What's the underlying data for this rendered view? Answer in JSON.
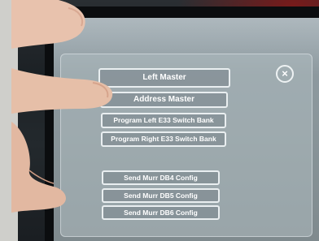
{
  "dialog": {
    "close_symbol": "×",
    "buttons": [
      {
        "label": "Left Master"
      },
      {
        "label": "Address Master"
      },
      {
        "label": "Program Left E33 Switch Bank"
      },
      {
        "label": "Program Right E33 Switch Bank"
      },
      {
        "label": "Send Murr DB4 Config"
      },
      {
        "label": "Send Murr DB5 Config"
      },
      {
        "label": "Send Murr DB6 Config"
      }
    ]
  },
  "icons": {
    "close": "close-icon"
  }
}
